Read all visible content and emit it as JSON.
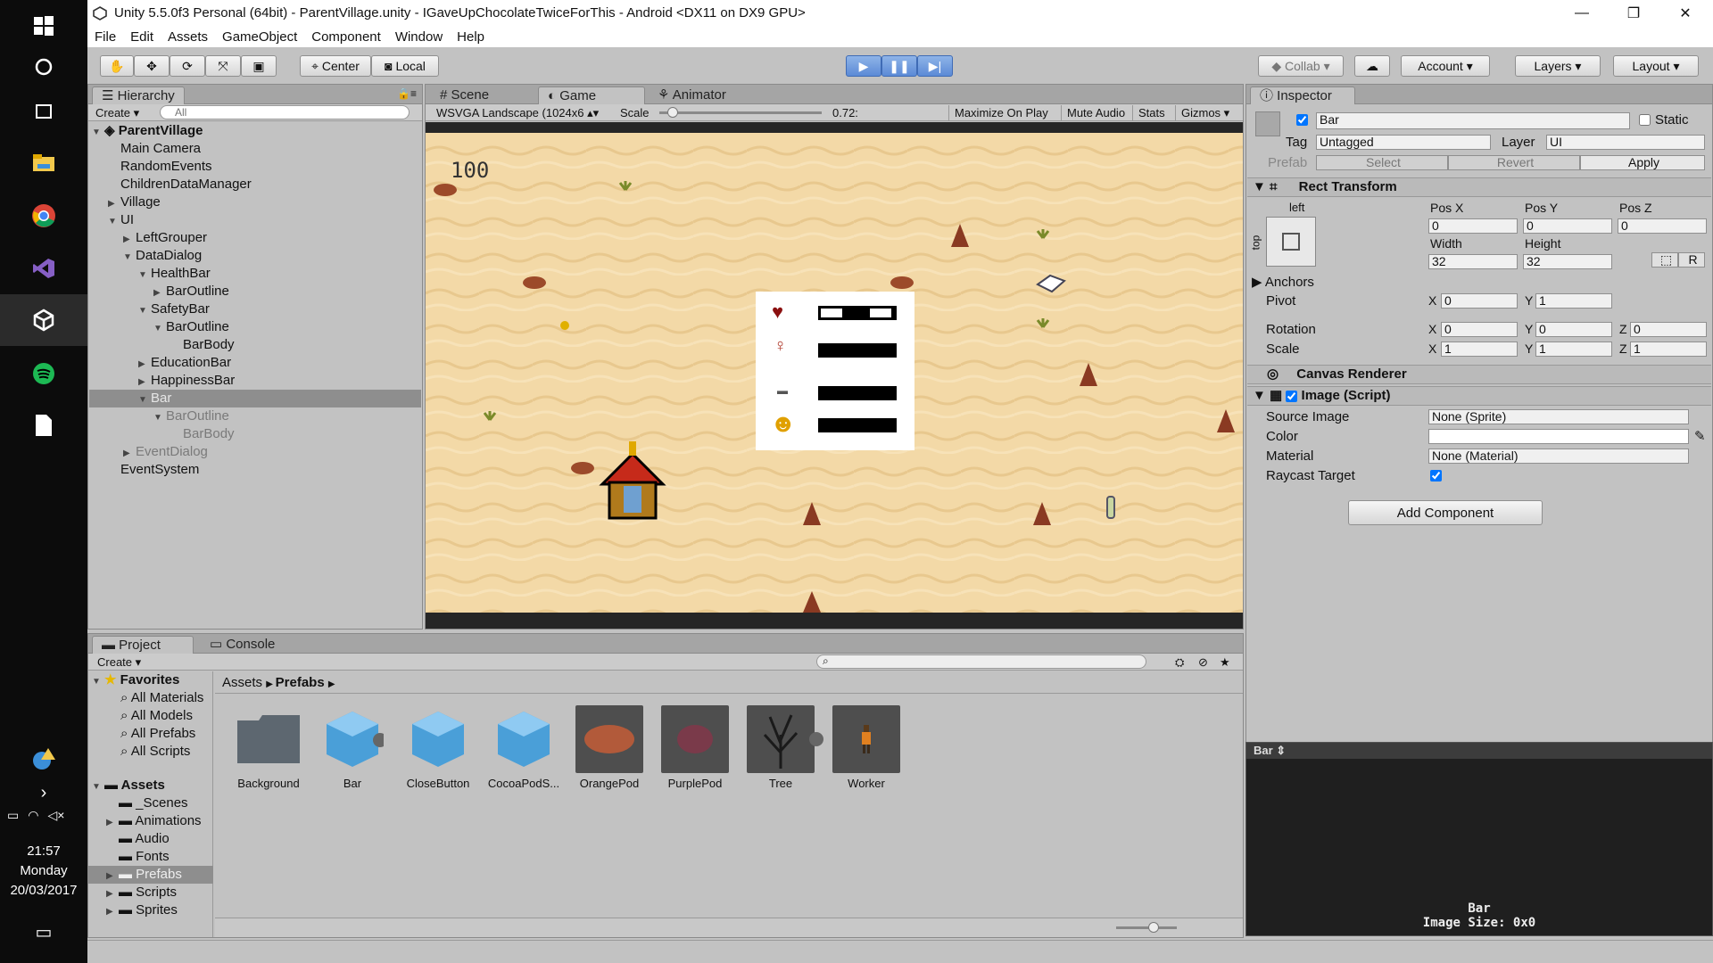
{
  "taskbar": {
    "time": "21:57",
    "day": "Monday",
    "date": "20/03/2017"
  },
  "window": {
    "title": "Unity 5.5.0f3 Personal (64bit) - ParentVillage.unity - IGaveUpChocolateTwiceForThis - Android <DX11 on DX9 GPU>"
  },
  "menu": [
    "File",
    "Edit",
    "Assets",
    "GameObject",
    "Component",
    "Window",
    "Help"
  ],
  "toolbar": {
    "center_label": "Center",
    "local_label": "Local",
    "collab_label": "Collab",
    "account_label": "Account",
    "layers_label": "Layers",
    "layout_label": "Layout"
  },
  "hierarchy": {
    "tab": "Hierarchy",
    "create": "Create",
    "search_placeholder": "All",
    "scene": "ParentVillage",
    "items": [
      "Main Camera",
      "RandomEvents",
      "ChildrenDataManager",
      "Village",
      "UI",
      "LeftGrouper",
      "DataDialog",
      "HealthBar",
      "BarOutline",
      "SafetyBar",
      "BarOutline",
      "BarBody",
      "EducationBar",
      "HappinessBar",
      "Bar",
      "BarOutline",
      "BarBody",
      "EventDialog",
      "EventSystem"
    ]
  },
  "game": {
    "tabs": [
      "Scene",
      "Game",
      "Animator"
    ],
    "aspect": "WSVGA Landscape (1024x6",
    "scale_label": "Scale",
    "scale_value": "0.72:",
    "scale_fraction": 0.05,
    "max_on_play": "Maximize On Play",
    "mute": "Mute Audio",
    "stats": "Stats",
    "gizmos": "Gizmos",
    "score": "100"
  },
  "inspector": {
    "tab": "Inspector",
    "name": "Bar",
    "static": "Static",
    "tag_label": "Tag",
    "tag": "Untagged",
    "layer_label": "Layer",
    "layer": "UI",
    "prefab": "Prefab",
    "select": "Select",
    "revert": "Revert",
    "apply": "Apply",
    "rect_transform": "Rect Transform",
    "anchor_h": "left",
    "anchor_v": "top",
    "pos_x_label": "Pos X",
    "pos_y_label": "Pos Y",
    "pos_z_label": "Pos Z",
    "pos_x": "0",
    "pos_y": "0",
    "pos_z": "0",
    "width_label": "Width",
    "height_label": "Height",
    "width": "32",
    "height": "32",
    "r_btn": "R",
    "anchors": "Anchors",
    "pivot": "Pivot",
    "pivot_x": "0",
    "pivot_y": "1",
    "rotation": "Rotation",
    "rot_x": "0",
    "rot_y": "0",
    "rot_z": "0",
    "scale": "Scale",
    "scale_x": "1",
    "scale_y": "1",
    "scale_z": "1",
    "x": "X",
    "y": "Y",
    "z": "Z",
    "canvas_renderer": "Canvas Renderer",
    "image_script": "Image (Script)",
    "source_image_label": "Source Image",
    "source_image": "None (Sprite)",
    "color_label": "Color",
    "material_label": "Material",
    "material": "None (Material)",
    "raycast_label": "Raycast Target",
    "add_component": "Add Component"
  },
  "preview": {
    "title": "Bar",
    "name": "Bar",
    "size": "Image Size: 0x0"
  },
  "project": {
    "tabs": [
      "Project",
      "Console"
    ],
    "create": "Create",
    "favorites": "Favorites",
    "fav_items": [
      "All Materials",
      "All Models",
      "All Prefabs",
      "All Scripts"
    ],
    "assets": "Assets",
    "asset_folders": [
      "_Scenes",
      "Animations",
      "Audio",
      "Fonts",
      "Prefabs",
      "Scripts",
      "Sprites"
    ],
    "breadcrumb": [
      "Assets",
      "Prefabs"
    ],
    "items": [
      "Background",
      "Bar",
      "CloseButton",
      "CocoaPodS...",
      "OrangePod",
      "PurplePod",
      "Tree",
      "Worker"
    ]
  },
  "colors": {
    "editor_bg": "#c2c2c2",
    "sand": "#f3d9a7",
    "play_blue": "#5b8ad6",
    "selected": "#8e8e8e"
  }
}
